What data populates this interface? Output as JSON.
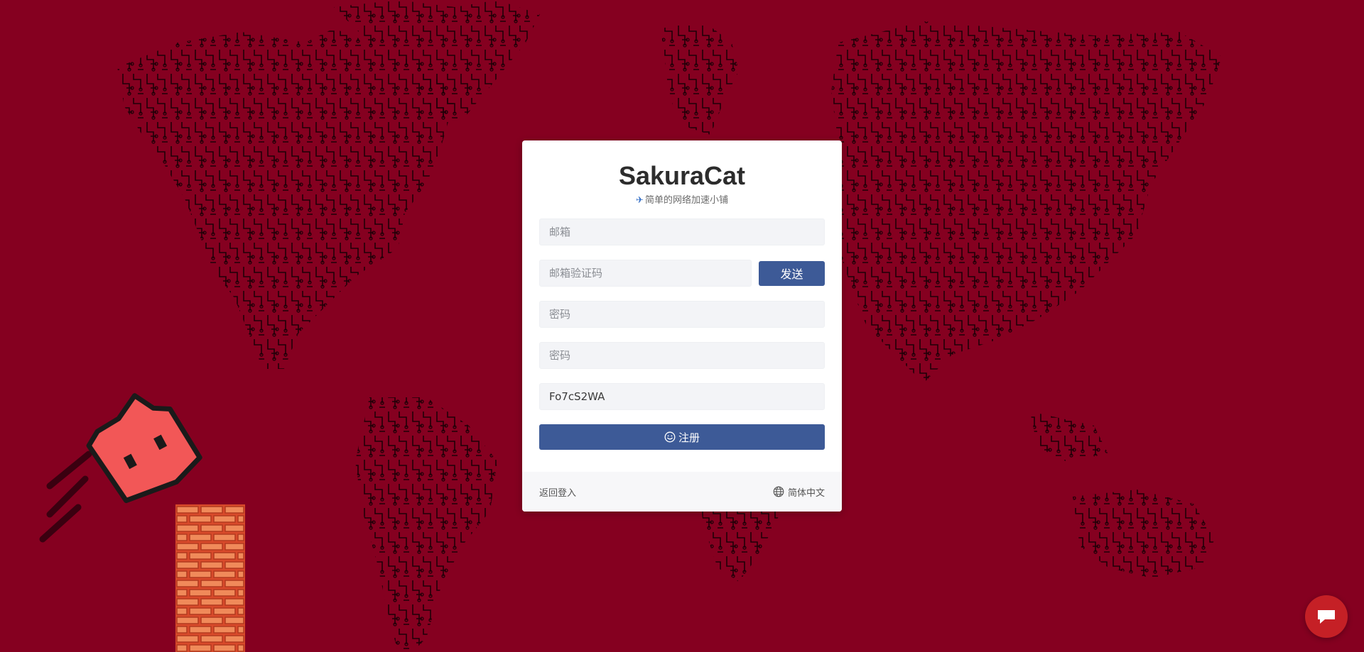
{
  "brand": {
    "title": "SakuraCat",
    "subtitle": "简单的网络加速小铺"
  },
  "form": {
    "email_placeholder": "邮箱",
    "email_code_placeholder": "邮箱验证码",
    "send_label": "发送",
    "password_placeholder": "密码",
    "password_confirm_placeholder": "密码",
    "invite_code_value": "Fo7cS2WA",
    "register_label": "注册"
  },
  "footer": {
    "back_label": "返回登入",
    "language_label": "简体中文"
  },
  "colors": {
    "background": "#850020",
    "primary_button": "#3d5a97",
    "chat_bubble": "#c52026",
    "cat_face": "#f25757"
  },
  "icons": {
    "subtitle": "airplane-icon",
    "register": "smile-icon",
    "language": "globe-icon",
    "chat": "chat-bubble-icon"
  }
}
